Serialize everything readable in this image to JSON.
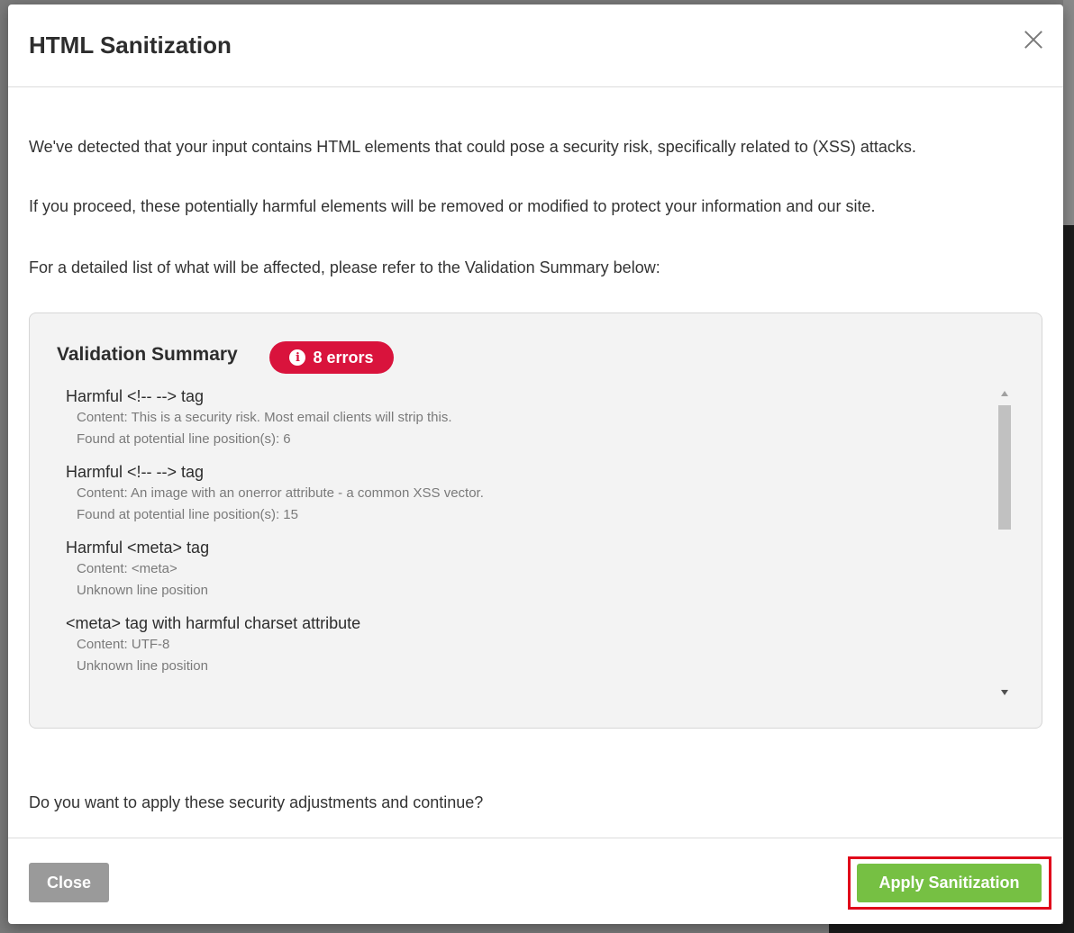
{
  "modal": {
    "title": "HTML Sanitization",
    "paragraphs": [
      "We've detected that your input contains HTML elements that could pose a security risk, specifically related to (XSS) attacks.",
      "If you proceed, these potentially harmful elements will be removed or modified to protect your information and our site.",
      "For a detailed list of what will be affected, please refer to the Validation Summary below:"
    ],
    "question": "Do you want to apply these security adjustments and continue?"
  },
  "summary": {
    "title": "Validation Summary",
    "badge": "8 errors",
    "badge_icon": "info-icon",
    "badge_color": "#d9133c",
    "items": [
      {
        "title": "Harmful <!-- --> tag",
        "content": "Content: This is a security risk. Most email clients will strip this.",
        "position": "Found at potential line position(s): 6"
      },
      {
        "title": "Harmful <!-- --> tag",
        "content": "Content: An image with an onerror attribute - a common XSS vector.",
        "position": "Found at potential line position(s): 15"
      },
      {
        "title": "Harmful <meta> tag",
        "content": "Content: <meta>",
        "position": "Unknown line position"
      },
      {
        "title": "<meta> tag with harmful charset attribute",
        "content": "Content: UTF-8",
        "position": "Unknown line position"
      }
    ]
  },
  "footer": {
    "close_label": "Close",
    "apply_label": "Apply Sanitization",
    "apply_color": "#76c043"
  }
}
